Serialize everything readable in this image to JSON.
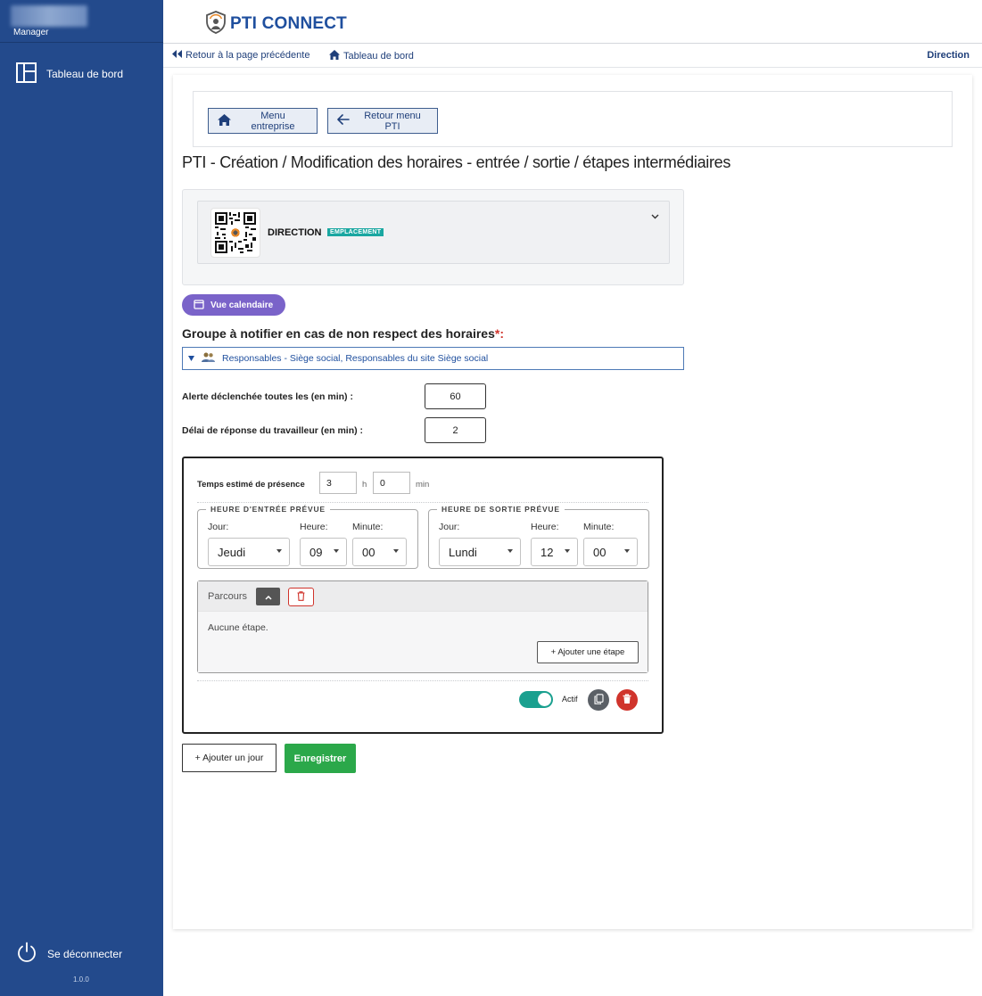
{
  "sidebar": {
    "role": "Manager",
    "nav_item": "Tableau de bord",
    "logout": "Se déconnecter",
    "version": "1.0.0"
  },
  "header": {
    "brand": "PTI CONNECT"
  },
  "breadcrumb": {
    "back": "Retour à la page précédente",
    "dashboard": "Tableau de bord",
    "current": "Direction"
  },
  "buttons": {
    "menu_entreprise": "Menu entreprise",
    "retour_menu_pti": "Retour menu PTI"
  },
  "page": {
    "title": "PTI - Création / Modification des horaires - entrée / sortie / étapes intermédiaires"
  },
  "location": {
    "name": "DIRECTION",
    "badge": "EMPLACEMENT"
  },
  "calendar_button": "Vue calendaire",
  "notify_group": {
    "label": "Groupe à notifier en cas de non respect des horaires",
    "required_mark": "*",
    "colon": ":",
    "selected": "Responsables - Siège social, Responsables du site Siège social"
  },
  "alert": {
    "interval_label": "Alerte déclenchée toutes les (en min) :",
    "interval_value": "60",
    "response_label": "Délai de réponse du travailleur (en min) :",
    "response_value": "2"
  },
  "schedule": {
    "estimated_label": "Temps estimé de présence",
    "hours_value": "3",
    "hours_unit": "h",
    "minutes_value": "0",
    "minutes_unit": "min",
    "entry": {
      "legend": "HEURE D'ENTRÉE PRÉVUE",
      "day_label": "Jour:",
      "hour_label": "Heure:",
      "minute_label": "Minute:",
      "day": "Jeudi",
      "hour": "09",
      "minute": "00"
    },
    "exit": {
      "legend": "HEURE DE SORTIE PRÉVUE",
      "day_label": "Jour:",
      "hour_label": "Heure:",
      "minute_label": "Minute:",
      "day": "Lundi",
      "hour": "12",
      "minute": "00"
    },
    "route": {
      "title": "Parcours",
      "empty": "Aucune étape.",
      "add_step": "+ Ajouter une étape"
    },
    "active_label": "Actif",
    "active": true
  },
  "actions": {
    "add_day": "+ Ajouter un jour",
    "save": "Enregistrer"
  },
  "colors": {
    "sidebar": "#234a8c",
    "brand": "#1f4f9e",
    "badge": "#1aa7a1",
    "calendar": "#7a63c9",
    "toggle": "#1aa08f",
    "save": "#2ba84a",
    "danger": "#d0342c"
  }
}
